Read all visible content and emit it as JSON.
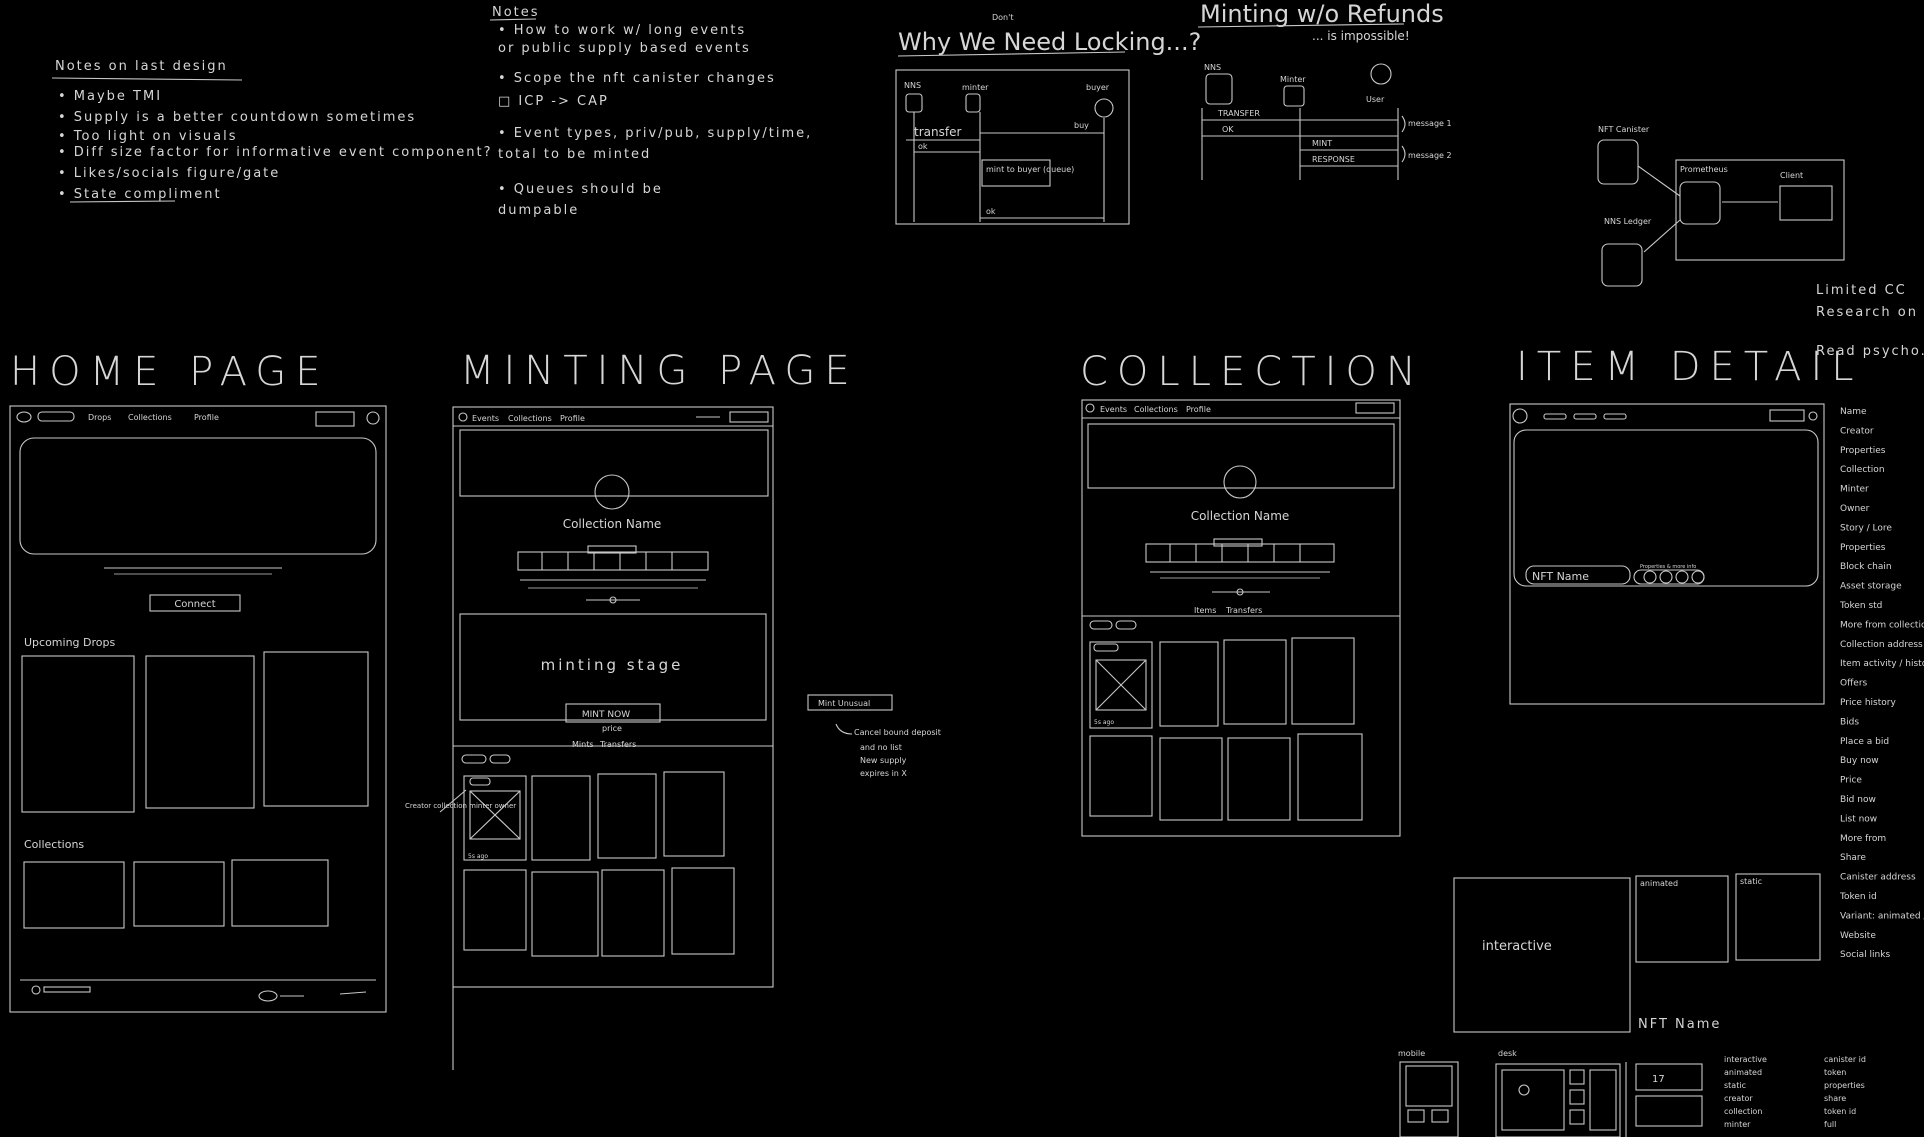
{
  "notes_last_design": {
    "heading": "Notes on last design",
    "items": [
      "• Maybe TMI",
      "• Supply is a better countdown sometimes",
      "• Too light on visuals",
      "• Diff size factor for informative event component?",
      "• Likes/socials figure/gate",
      "• State compliment"
    ]
  },
  "notes_top": {
    "heading": "Notes",
    "items": [
      "• How to work w/ long events",
      "  or public supply based events",
      "• Scope the nft canister changes",
      "□ ICP -> CAP",
      "• Event types, priv/pub, supply/time,",
      "  total to be minted",
      "• Queues should be",
      "  dumpable"
    ]
  },
  "locking": {
    "title": "Why We Need Locking...?",
    "caret_word": "Don't",
    "actors": [
      "NNS",
      "minter",
      "buyer"
    ],
    "messages": [
      "transfer",
      "ok",
      "mint to buyer (queue)",
      "ok",
      "buy"
    ]
  },
  "minting_refunds": {
    "title": "Minting w/o Refunds",
    "subtitle": "... is impossible!",
    "actors": [
      "NNS",
      "Minter",
      "User"
    ],
    "messages": [
      "TRANSFER",
      "OK",
      "MINT",
      "RESPONSE"
    ],
    "annotations": [
      "message 1",
      "message 2"
    ]
  },
  "architecture": {
    "nodes": [
      "NFT Canister",
      "Prometheus",
      "Client",
      "NNS Ledger"
    ]
  },
  "todo": {
    "items": [
      "Limited CC",
      "Research on markets",
      "Read psycho..."
    ]
  },
  "home_page": {
    "title": "HOME PAGE",
    "nav": [
      "Drops",
      "Collections",
      "Profile"
    ],
    "connect_label": "Connect",
    "upcoming_label": "Upcoming Drops",
    "collections_label": "Collections"
  },
  "minting_page": {
    "title": "MINTING PAGE",
    "nav": [
      "Events",
      "Collections",
      "Profile"
    ],
    "collection_name": "Collection Name",
    "stage_label": "minting stage",
    "mint_button": "MINT NOW",
    "price_label": "price",
    "tabs": [
      "Mints",
      "Transfers"
    ],
    "side_note": "Creator collection minter owner",
    "age_label": "5s ago"
  },
  "mint_popup": {
    "label": "Mint Unusual",
    "notes": [
      "Cancel bound deposit",
      "and no list",
      "New supply",
      "expires in X"
    ]
  },
  "collection_page": {
    "title": "COLLECTION",
    "nav": [
      "Events",
      "Collections",
      "Profile"
    ],
    "collection_name": "Collection Name",
    "tabs": [
      "Items",
      "Transfers"
    ],
    "age_label": "5s ago"
  },
  "item_detail": {
    "title": "ITEM DETAIL",
    "nft_name_label": "NFT Name",
    "attributes_label": "Properties & more info"
  },
  "attributes_list": {
    "items": [
      "Name",
      "Creator",
      "Properties",
      "Collection",
      "Minter",
      "Owner",
      "Story / Lore",
      "Properties",
      "Block chain",
      "Asset storage",
      "Token std",
      "More from collection",
      "Collection address",
      "Item activity / history",
      "Offers",
      "Price history",
      "Bids",
      "Place a bid",
      "Buy now",
      "Price",
      "Bid now",
      "List now",
      "More from",
      "Share",
      "Canister address",
      "Token id",
      "Variant: animated / static / interactive / thumbnail",
      "Website",
      "Social links"
    ]
  },
  "media_variants": {
    "interactive_label": "interactive",
    "animated_label": "animated",
    "static_label": "static",
    "nft_name_label": "NFT Name",
    "mobile_label": "mobile",
    "desktop_label": "desk",
    "legend_left": [
      "interactive",
      "animated",
      "static",
      "creator",
      "collection",
      "minter"
    ],
    "legend_right": [
      "canister id",
      "token",
      "properties",
      "share",
      "token id",
      "full"
    ]
  }
}
